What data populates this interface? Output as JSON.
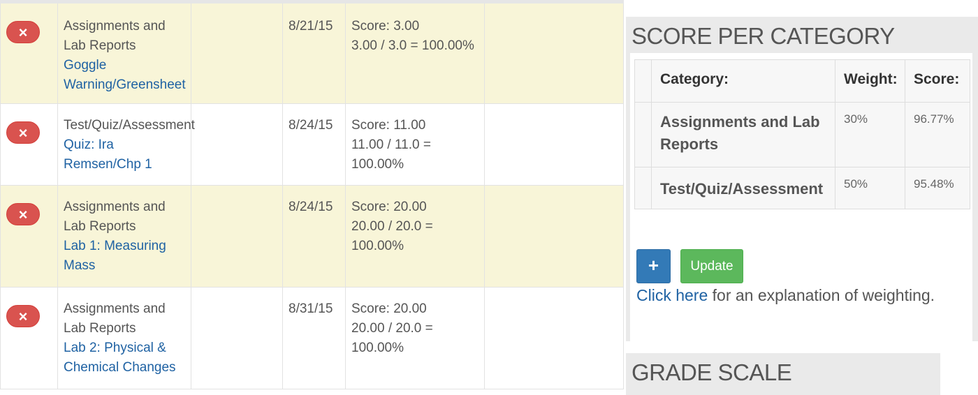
{
  "assignments": [
    {
      "delete_icon": "×",
      "category": "Assignments and Lab Reports",
      "name": "Goggle Warning/Greensheet",
      "date": "8/21/15",
      "score": "Score: 3.00",
      "calc": "3.00 / 3.0 = 100.00%",
      "highlighted": true
    },
    {
      "delete_icon": "×",
      "category": "Test/Quiz/Assessment",
      "name": "Quiz: Ira Remsen/Chp 1",
      "date": "8/24/15",
      "score": "Score: 11.00",
      "calc": "11.00 / 11.0 = 100.00%",
      "highlighted": false
    },
    {
      "delete_icon": "×",
      "category": "Assignments and Lab Reports",
      "name": "Lab 1: Measuring Mass",
      "date": "8/24/15",
      "score": "Score: 20.00",
      "calc": "20.00 / 20.0 = 100.00%",
      "highlighted": true
    },
    {
      "delete_icon": "×",
      "category": "Assignments and Lab Reports",
      "name": "Lab 2: Physical & Chemical Changes",
      "date": "8/31/15",
      "score": "Score: 20.00",
      "calc": "20.00 / 20.0 = 100.00%",
      "highlighted": false
    }
  ],
  "score_panel": {
    "title": "SCORE PER CATEGORY",
    "headers": {
      "category": "Category:",
      "weight": "Weight:",
      "score": "Score:"
    },
    "rows": [
      {
        "category": "Assignments and Lab Reports",
        "weight": "30%",
        "score": "96.77%"
      },
      {
        "category": "Test/Quiz/Assessment",
        "weight": "50%",
        "score": "95.48%"
      }
    ],
    "add_button": "+",
    "update_button": "Update",
    "explain_link": "Click here",
    "explain_text": " for an explanation of weighting."
  },
  "grade_panel": {
    "title": "GRADE SCALE"
  },
  "colors": {
    "highlight_row": "#f8f5d8",
    "delete": "#d9534f",
    "primary": "#337ab7",
    "success": "#5cb85c",
    "link": "#1f62a3"
  }
}
